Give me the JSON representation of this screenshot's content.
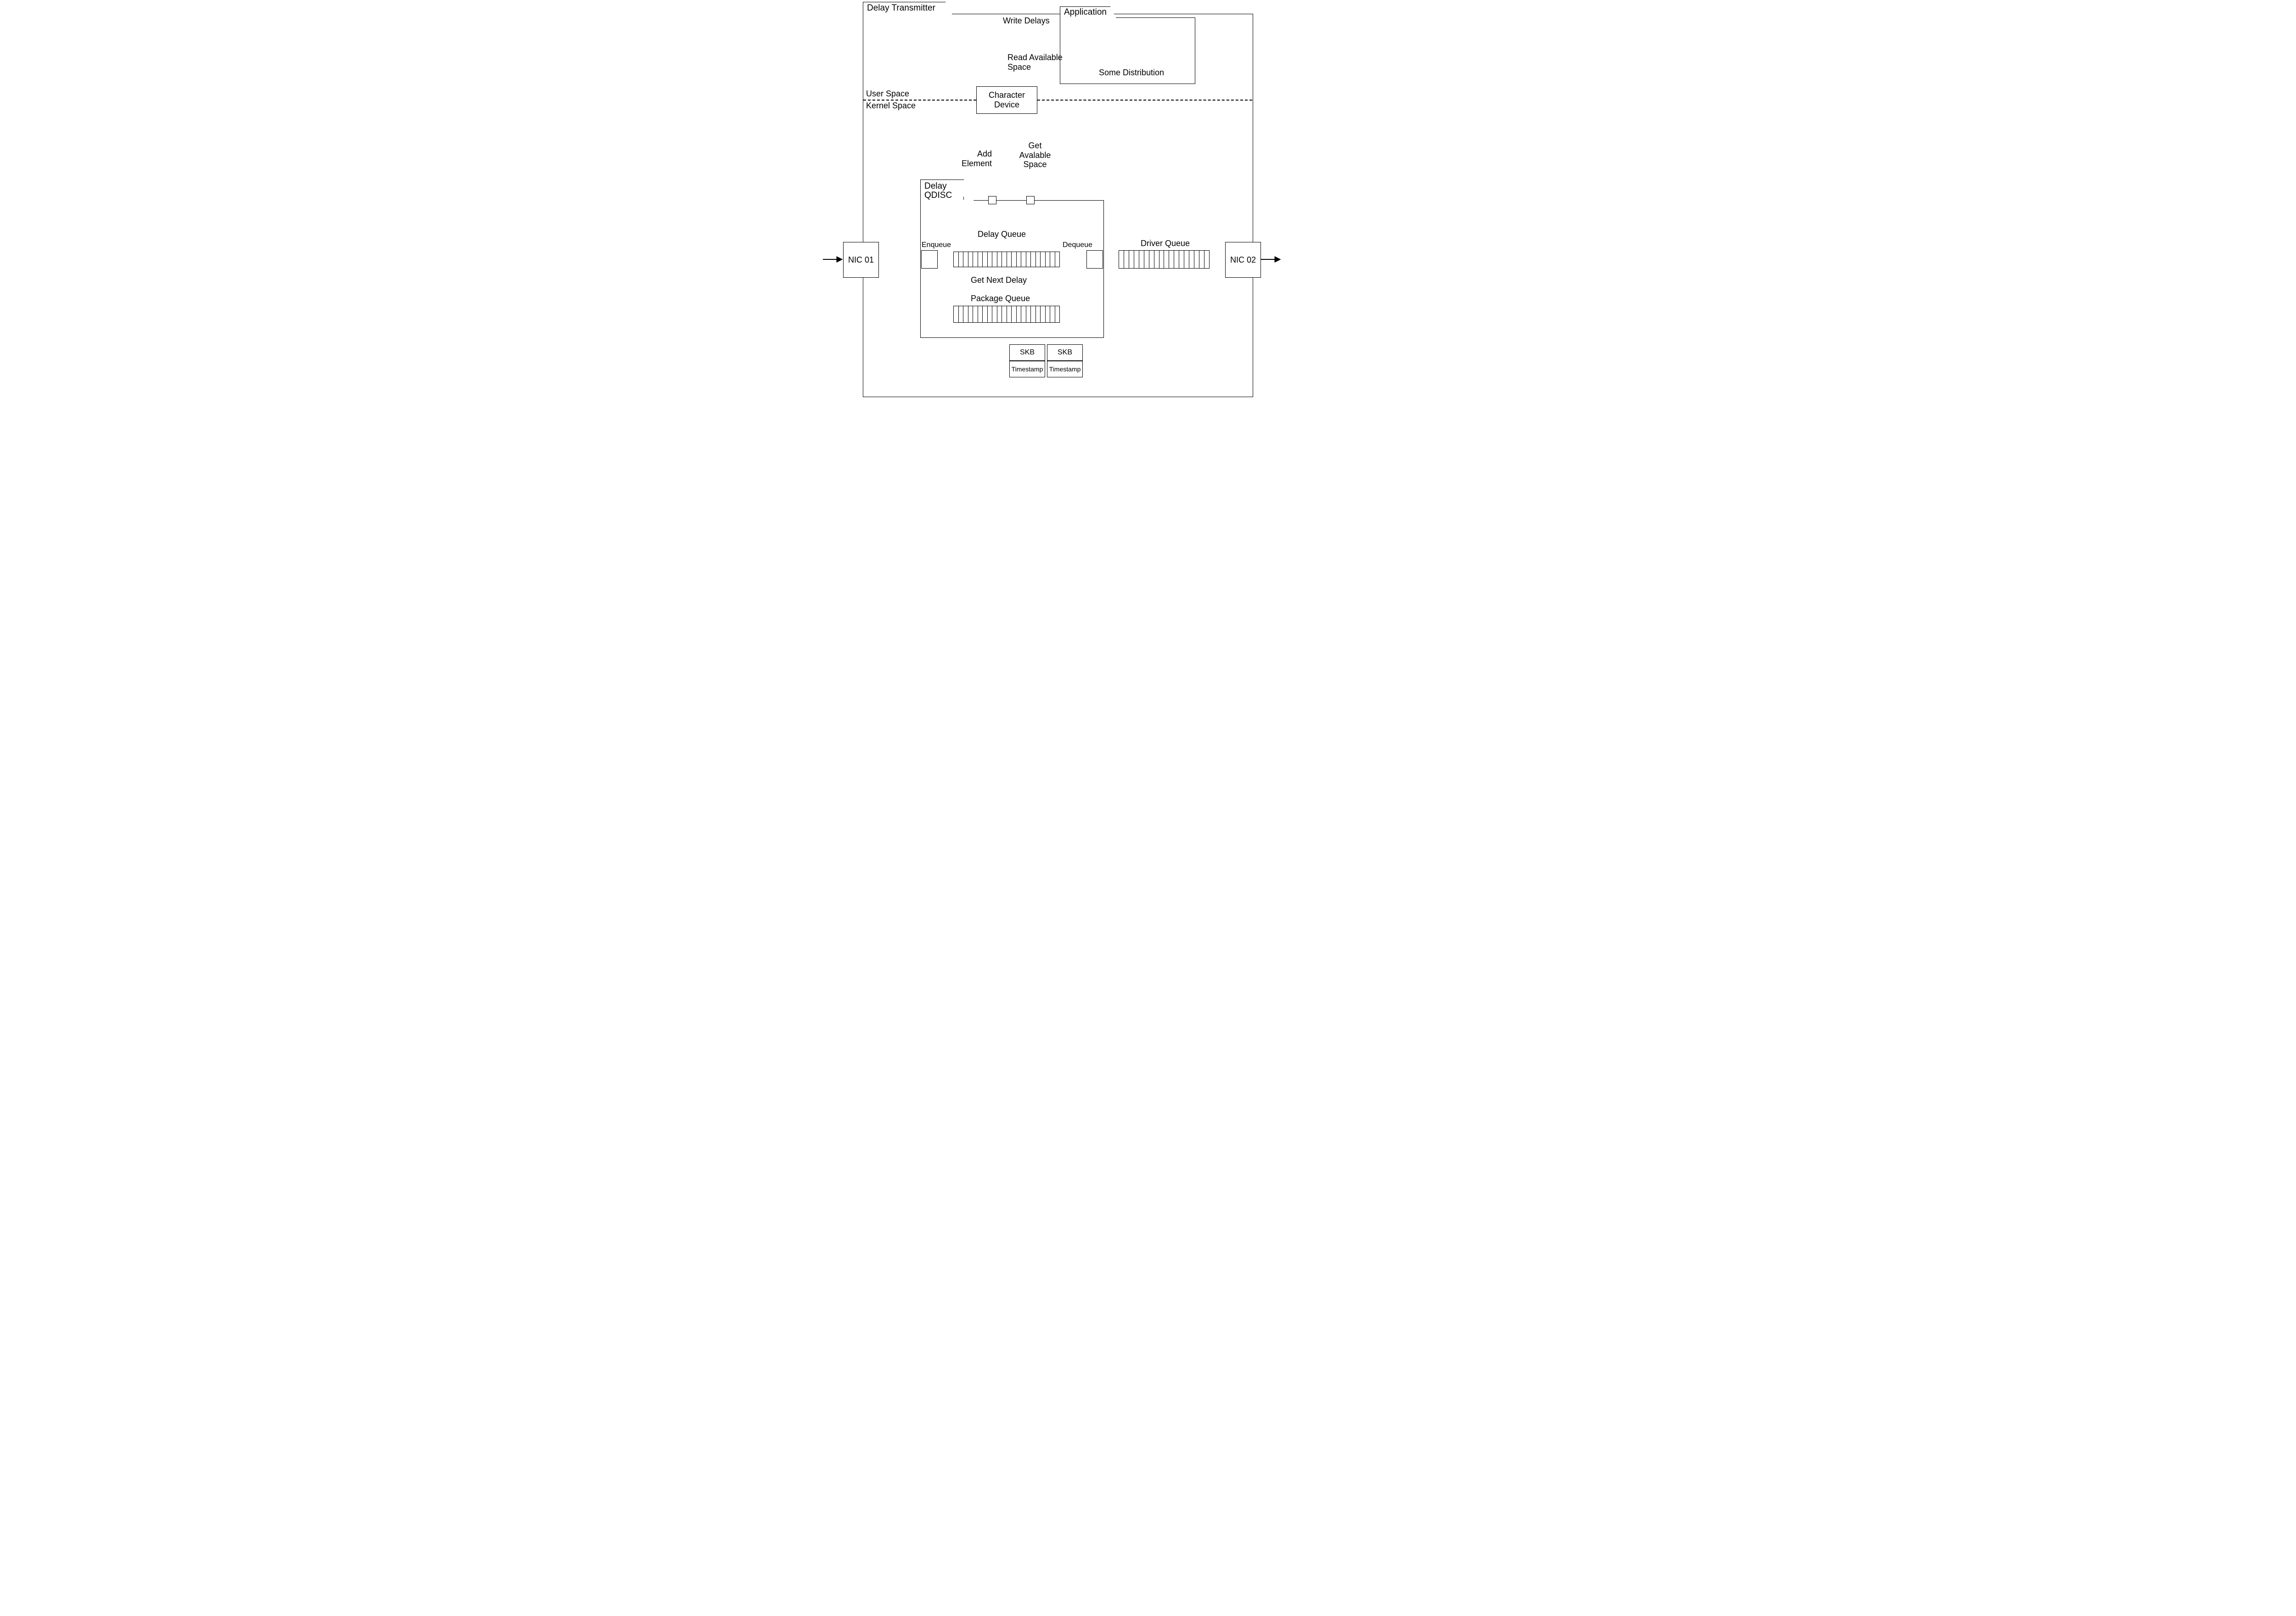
{
  "titles": {
    "diagram_tab": "Delay Transmitter",
    "application_tab": "Application",
    "qdisc_tab": "Delay QDISC"
  },
  "boxes": {
    "nic01": "NIC 01",
    "nic02": "NIC 02",
    "char_device": "Character Device",
    "distribution": "Some Distribution",
    "skb1_top": "SKB",
    "skb1_bot": "Timestamp",
    "skb2_top": "SKB",
    "skb2_bot": "Timestamp"
  },
  "labels": {
    "user_space": "User Space",
    "kernel_space": "Kernel Space",
    "write_delays": "Write Delays",
    "read_avail": "Read Available Space",
    "add_element": "Add Element",
    "get_avail": "Get Avalable Space",
    "delay_queue": "Delay Queue",
    "package_queue": "Package Queue",
    "get_next_delay": "Get Next Delay",
    "enqueue": "Enqueue",
    "dequeue": "Dequeue",
    "driver_queue": "Driver Queue"
  },
  "queue_cells": {
    "delay": 22,
    "package": 22,
    "driver": 18
  }
}
